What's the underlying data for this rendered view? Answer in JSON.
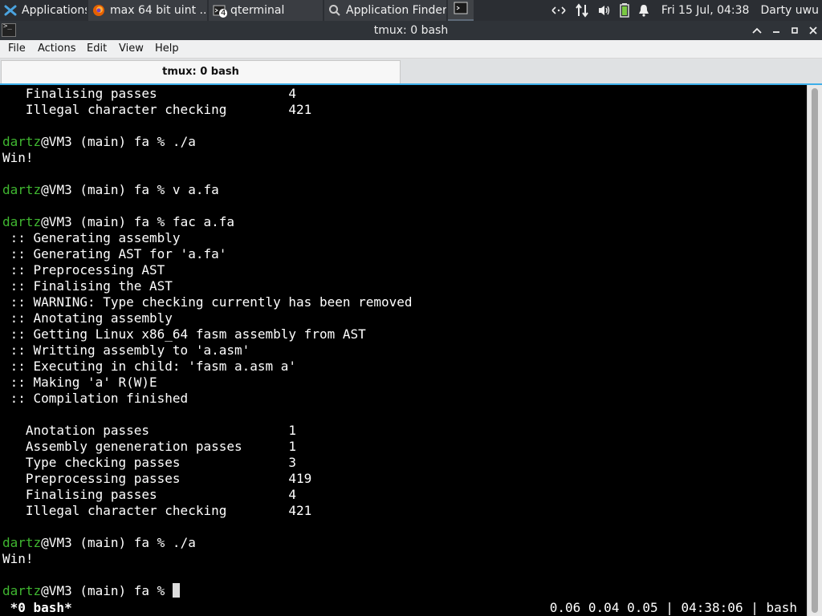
{
  "panel": {
    "apps_label": "Applications",
    "tasks": [
      {
        "label": "max 64 bit uint ..."
      },
      {
        "label": "qterminal",
        "badge": "4"
      },
      {
        "label": "Application Finder"
      }
    ],
    "clock": "Fri 15 Jul, 04:38",
    "user": "Darty uwu",
    "icons": [
      "xfce-mouse-icon",
      "firefox-icon",
      "terminal-icon",
      "search-icon",
      "network-activity-icon",
      "network-updown-icon",
      "volume-icon",
      "battery-icon",
      "notification-bell-icon"
    ]
  },
  "window": {
    "title": "tmux: 0 bash",
    "buttons": [
      "up-arrow",
      "minimize",
      "maximize",
      "close"
    ]
  },
  "menubar": {
    "items": [
      "File",
      "Actions",
      "Edit",
      "View",
      "Help"
    ]
  },
  "tabs": [
    {
      "label": "tmux: 0 bash",
      "active": true
    }
  ],
  "terminal": {
    "prompt_user": "dartz",
    "lines": [
      {
        "text": "   Finalising passes                 4"
      },
      {
        "text": "   Illegal character checking        421"
      },
      {
        "text": ""
      },
      {
        "prompt": true,
        "text": "@VM3 (main) fa % ./a"
      },
      {
        "text": "Win!"
      },
      {
        "text": ""
      },
      {
        "prompt": true,
        "text": "@VM3 (main) fa % v a.fa"
      },
      {
        "text": ""
      },
      {
        "prompt": true,
        "text": "@VM3 (main) fa % fac a.fa"
      },
      {
        "text": " :: Generating assembly"
      },
      {
        "text": " :: Generating AST for 'a.fa'"
      },
      {
        "text": " :: Preprocessing AST"
      },
      {
        "text": " :: Finalising the AST"
      },
      {
        "text": " :: WARNING: Type checking currently has been removed"
      },
      {
        "text": " :: Anotating assembly"
      },
      {
        "text": " :: Getting Linux x86_64 fasm assembly from AST"
      },
      {
        "text": " :: Writting assembly to 'a.asm'"
      },
      {
        "text": " :: Executing in child: 'fasm a.asm a'"
      },
      {
        "text": " :: Making 'a' R(W)E"
      },
      {
        "text": " :: Compilation finished"
      },
      {
        "text": ""
      },
      {
        "text": "   Anotation passes                  1"
      },
      {
        "text": "   Assembly geneneration passes      1"
      },
      {
        "text": "   Type checking passes              3"
      },
      {
        "text": "   Preprocessing passes              419"
      },
      {
        "text": "   Finalising passes                 4"
      },
      {
        "text": "   Illegal character checking        421"
      },
      {
        "text": ""
      },
      {
        "prompt": true,
        "text": "@VM3 (main) fa % ./a"
      },
      {
        "text": "Win!"
      },
      {
        "text": ""
      },
      {
        "prompt": true,
        "text": "@VM3 (main) fa % ",
        "cursor": true
      }
    ],
    "status_left": " *0 bash*",
    "status_right": "0.06 0.04 0.05 | 04:38:06 | bash"
  },
  "colors": {
    "panel_bg": "#2b2e33",
    "titlebar_bg": "#2f3338",
    "menubar_bg": "#eff0f1",
    "tab_accent": "#3daee9",
    "terminal_bg": "#000000",
    "terminal_fg": "#ffffff",
    "prompt_user": "#3fb630"
  }
}
